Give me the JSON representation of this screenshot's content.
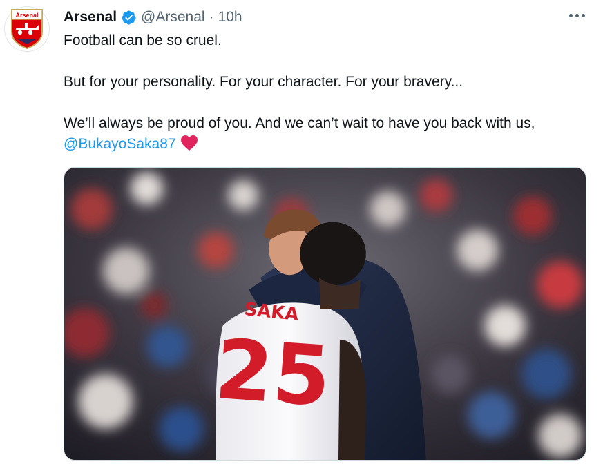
{
  "tweet": {
    "display_name": "Arsenal",
    "handle": "@Arsenal",
    "separator": "·",
    "timestamp": "10h",
    "avatar_badge_text": "Arsenal",
    "body": {
      "line1": "Football can be so cruel.",
      "line2": "But for your personality. For your character. For your bravery...",
      "line3": "We’ll always be proud of you. And we can’t wait to have you back with us,",
      "mention": "@BukayoSaka87",
      "emoji": "heart"
    },
    "photo": {
      "shirt_name": "SAKA",
      "shirt_number": "25"
    }
  },
  "colors": {
    "verified_badge": "#1d9bf0",
    "mention_link": "#1d9bf0",
    "heart": "#e0245e",
    "arsenal_red": "#db0007"
  },
  "icons": [
    "verified-badge-icon",
    "more-options-icon",
    "red-heart-icon",
    "arsenal-crest-icon"
  ]
}
